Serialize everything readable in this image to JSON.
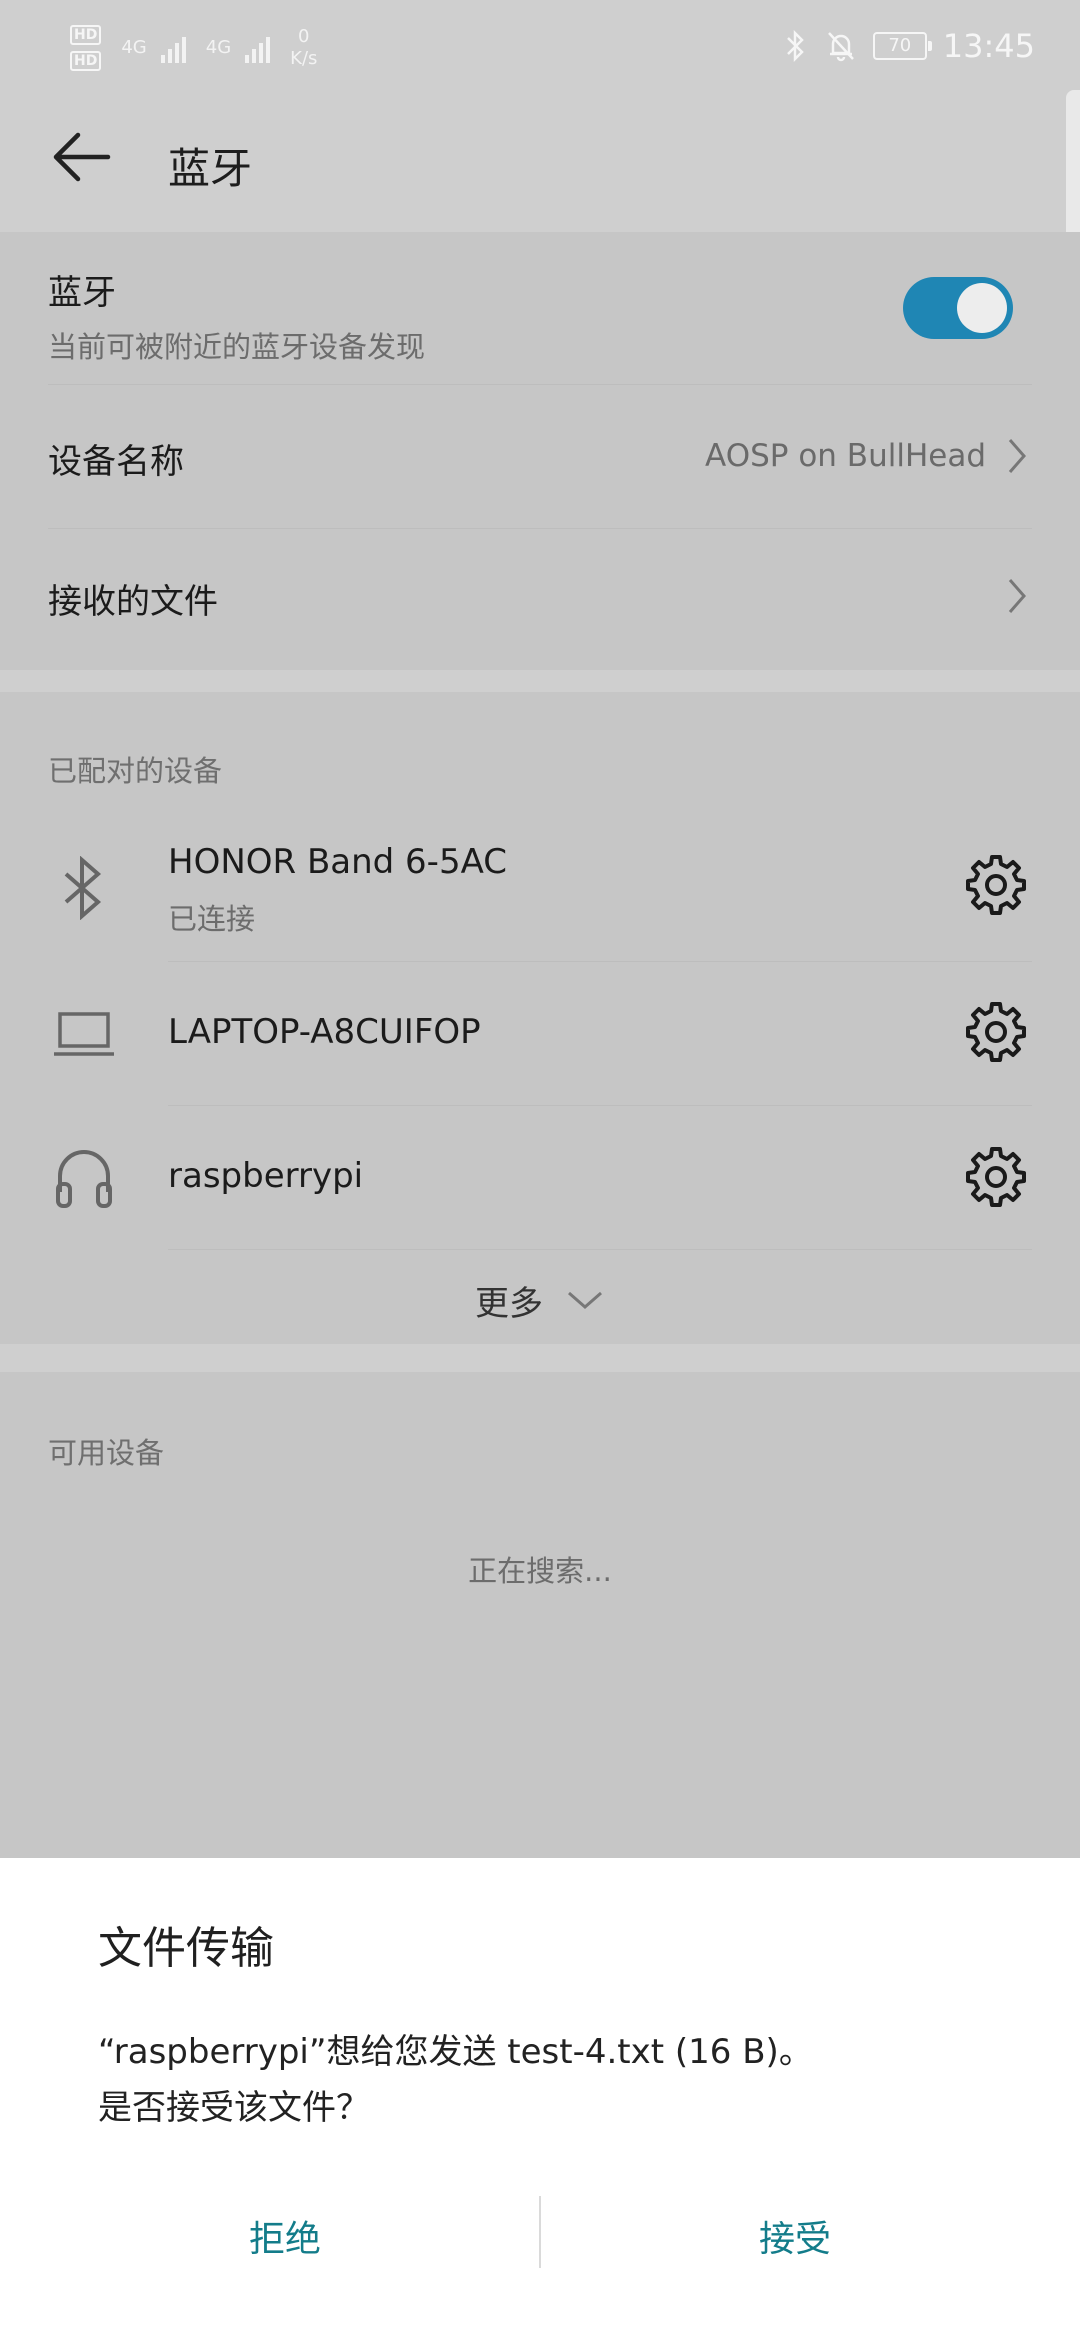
{
  "status_bar": {
    "hd1": "HD",
    "hd2": "HD",
    "net1": "4G",
    "net2": "4G",
    "speed_value": "0",
    "speed_unit": "K/s",
    "battery": "70",
    "time": "13:45"
  },
  "header": {
    "title": "蓝牙"
  },
  "bluetooth": {
    "title": "蓝牙",
    "subtitle": "当前可被附近的蓝牙设备发现",
    "enabled": true
  },
  "device_name": {
    "label": "设备名称",
    "value": "AOSP on BullHead"
  },
  "received_files": {
    "label": "接收的文件"
  },
  "paired": {
    "section_title": "已配对的设备",
    "devices": [
      {
        "name": "HONOR Band 6-5AC",
        "status": "已连接",
        "icon": "bluetooth-icon"
      },
      {
        "name": "LAPTOP-A8CUIFOP",
        "status": "",
        "icon": "laptop-icon"
      },
      {
        "name": "raspberrypi",
        "status": "",
        "icon": "headset-icon"
      }
    ],
    "more_label": "更多"
  },
  "available": {
    "section_title": "可用设备",
    "searching": "正在搜索..."
  },
  "dialog": {
    "title": "文件传输",
    "message_line1": "“raspberrypi”想给您发送 test-4.txt (16 B)。",
    "message_line2": "是否接受该文件？",
    "reject_label": "拒绝",
    "accept_label": "接受"
  },
  "colors": {
    "accent_toggle": "#1f86b4",
    "dialog_button": "#137c8a",
    "dimmed_background": "#cfcfcf"
  }
}
